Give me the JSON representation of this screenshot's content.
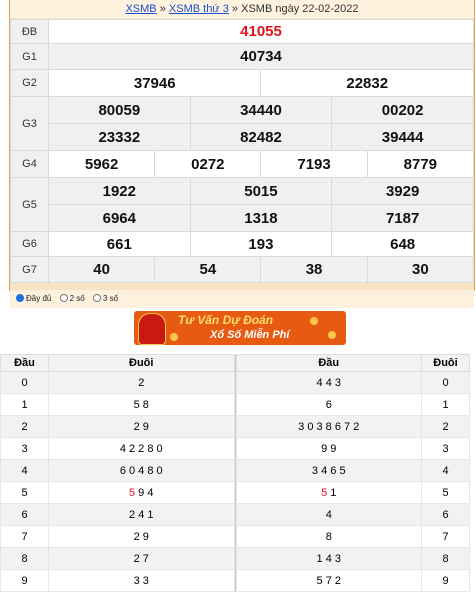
{
  "breadcrumb": {
    "link1": "XSMB",
    "sep1": "»",
    "link2": "XSMB thứ 3",
    "sep2": "»",
    "current": "XSMB ngày 22-02-2022"
  },
  "prizes": {
    "db": {
      "label": "ĐB",
      "numbers": [
        "41055"
      ]
    },
    "g1": {
      "label": "G1",
      "numbers": [
        "40734"
      ]
    },
    "g2": {
      "label": "G2",
      "numbers": [
        "37946",
        "22832"
      ]
    },
    "g3": {
      "label": "G3",
      "numbers": [
        "80059",
        "34440",
        "00202",
        "23332",
        "82482",
        "39444"
      ]
    },
    "g4": {
      "label": "G4",
      "numbers": [
        "5962",
        "0272",
        "7193",
        "8779"
      ]
    },
    "g5": {
      "label": "G5",
      "numbers": [
        "1922",
        "5015",
        "3929",
        "6964",
        "1318",
        "7187"
      ]
    },
    "g6": {
      "label": "G6",
      "numbers": [
        "661",
        "193",
        "648"
      ]
    },
    "g7": {
      "label": "G7",
      "numbers": [
        "40",
        "54",
        "38",
        "30"
      ]
    }
  },
  "options": {
    "full": "Đầy đủ",
    "two": "2 số",
    "three": "3 số",
    "selected": "full"
  },
  "banner": {
    "line1": "Tư Vấn Dự Đoán",
    "line2": "Xổ Số Miễn Phí"
  },
  "loto": {
    "headers": {
      "dau": "Đầu",
      "duoi": "Đuôi",
      "dau2": "Đầu",
      "duoi2": "Đuôi"
    },
    "rows": [
      {
        "dau": "0",
        "duoi": "2",
        "dau2": "4 4 3",
        "duoi2": "0"
      },
      {
        "dau": "1",
        "duoi": "5 8",
        "dau2": "6",
        "duoi2": "1"
      },
      {
        "dau": "2",
        "duoi": "2 9",
        "dau2": "3 0 3 8 6 7 2",
        "duoi2": "2"
      },
      {
        "dau": "3",
        "duoi": "4 2 2 8 0",
        "dau2": "9 9",
        "duoi2": "3"
      },
      {
        "dau": "4",
        "duoi": "6 0 4 8 0",
        "dau2": "3 4 6 5",
        "duoi2": "4"
      },
      {
        "dau": "5",
        "duoi_red": "5",
        "duoi_rest": " 9 4",
        "dau2_red": "5",
        "dau2_rest": " 1",
        "duoi2": "5"
      },
      {
        "dau": "6",
        "duoi": "2 4 1",
        "dau2": "4",
        "duoi2": "6"
      },
      {
        "dau": "7",
        "duoi": "2 9",
        "dau2": "8",
        "duoi2": "7"
      },
      {
        "dau": "8",
        "duoi": "2 7",
        "dau2": "1 4 3",
        "duoi2": "8"
      },
      {
        "dau": "9",
        "duoi": "3 3",
        "dau2": "5 7 2",
        "duoi2": "9"
      }
    ]
  },
  "colors": {
    "special": "#e0141e",
    "accent": "#e8a44a",
    "link": "#1a4fd0"
  }
}
